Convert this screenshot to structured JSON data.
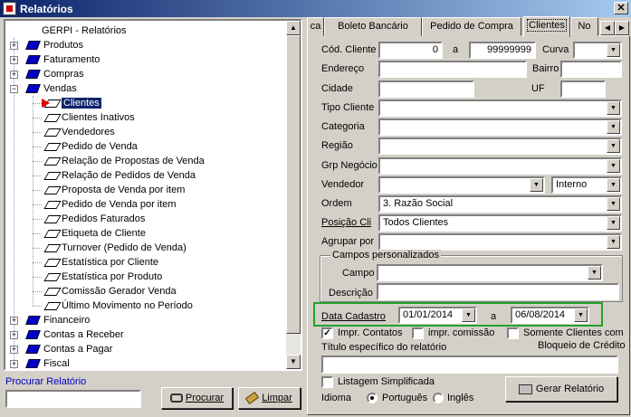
{
  "window": {
    "title": "Relatórios"
  },
  "tree": {
    "root": "GERPI - Relatórios",
    "groups": [
      {
        "label": "Produtos",
        "expanded": false
      },
      {
        "label": "Faturamento",
        "expanded": false
      },
      {
        "label": "Compras",
        "expanded": false
      },
      {
        "label": "Vendas",
        "expanded": true
      },
      {
        "label": "Financeiro",
        "expanded": false
      },
      {
        "label": "Contas a Receber",
        "expanded": false
      },
      {
        "label": "Contas a Pagar",
        "expanded": false
      },
      {
        "label": "Fiscal",
        "expanded": false
      }
    ],
    "vendas_items": [
      "Clientes",
      "Clientes Inativos",
      "Vendedores",
      "Pedido de Venda",
      "Relação de Propostas de Venda",
      "Relação de Pedidos de Venda",
      "Proposta de Venda por item",
      "Pedido de Venda por item",
      "Pedidos Faturados",
      "Etiqueta de Cliente",
      "Turnover (Pedido de Venda)",
      "Estatística por Cliente",
      "Estatística por Produto",
      "Comissão Gerador Venda",
      "Último Movimento no Período"
    ],
    "selected": "Clientes"
  },
  "search": {
    "label": "Procurar Relatório",
    "value": "",
    "search_button": "Procurar",
    "clear_button": "Limpar"
  },
  "tabs": [
    {
      "label": "ca",
      "active": false
    },
    {
      "label": "Boleto Bancário",
      "active": false
    },
    {
      "label": "Pedido de Compra",
      "active": false
    },
    {
      "label": "Clientes",
      "active": true
    },
    {
      "label": "No",
      "active": false
    }
  ],
  "form": {
    "cod_cliente_label": "Cód. Cliente",
    "cod_from": "0",
    "a_label": "a",
    "cod_to": "99999999",
    "curva_label": "Curva",
    "curva_value": "",
    "endereco_label": "Endereço",
    "endereco_value": "",
    "bairro_label": "Bairro",
    "bairro_value": "",
    "cidade_label": "Cidade",
    "cidade_value": "",
    "uf_label": "UF",
    "uf_value": "",
    "tipo_cliente_label": "Tipo Cliente",
    "tipo_cliente_value": "",
    "categoria_label": "Categoria",
    "categoria_value": "",
    "regiao_label": "Região",
    "regiao_value": "",
    "grp_negocio_label": "Grp Negócio",
    "grp_negocio_value": "",
    "vendedor_label": "Vendedor",
    "vendedor_value": "",
    "vendedor_tipo": "Interno",
    "ordem_label": "Ordem",
    "ordem_value": "3. Razão Social",
    "posicao_label": "Posição Cli",
    "posicao_value": "Todos Clientes",
    "agrupar_label": "Agrupar  por",
    "agrupar_value": "",
    "campos_group_label": "Campos personalizados",
    "campo_label": "Campo",
    "campo_value": "",
    "descricao_label": "Descrição",
    "descricao_value": "",
    "data_cadastro_label": "Data Cadastro",
    "data_from": "01/01/2014",
    "data_a_label": "a",
    "data_to": "06/08/2014",
    "impr_contatos_label": "Impr. Contatos",
    "impr_contatos_checked": true,
    "impr_comissao_label": "impr. comissão",
    "impr_comissao_checked": false,
    "somente_label_1": "Somente Clientes com",
    "somente_label_2": "Bloqueio de Crédito",
    "somente_checked": false,
    "titulo_label": "Título específico do relatório",
    "titulo_value": "",
    "listagem_label": "Listagem Simplificada",
    "listagem_checked": false,
    "idioma_label": "Idioma",
    "idioma_options": [
      "Português",
      "Inglês"
    ],
    "idioma_selected": "Português",
    "gerar_button": "Gerar Relatório"
  },
  "colors": {
    "highlight_box": "#22a22a",
    "titlebar": "#0a246a",
    "selection": "#0a246a"
  }
}
